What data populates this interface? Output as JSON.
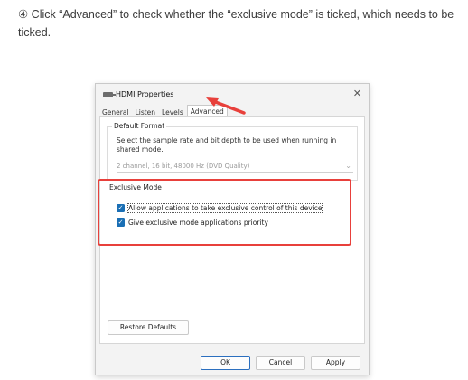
{
  "instruction": "④ Click “Advanced” to check whether the “exclusive mode” is ticked, which needs to be ticked.",
  "dialog": {
    "title": "HDMI Properties",
    "close_glyph": "✕",
    "tabs": [
      "General",
      "Listen",
      "Levels",
      "Advanced"
    ],
    "active_tab": "Advanced",
    "default_format": {
      "label": "Default Format",
      "description": "Select the sample rate and bit depth to be used when running in shared mode.",
      "selected": "2 channel, 16 bit, 48000 Hz (DVD Quality)"
    },
    "exclusive_mode": {
      "label": "Exclusive Mode",
      "options": [
        {
          "label": "Allow applications to take exclusive control of this device",
          "checked": true
        },
        {
          "label": "Give exclusive mode applications priority",
          "checked": true
        }
      ]
    },
    "restore_defaults": "Restore Defaults",
    "buttons": {
      "ok": "OK",
      "cancel": "Cancel",
      "apply": "Apply"
    }
  },
  "colors": {
    "highlight_red": "#e8403b",
    "checkbox_blue": "#1a6fb5"
  },
  "icons": {
    "title": "speaker-icon",
    "arrow": "red-arrow-icon",
    "check": "checkmark-icon"
  }
}
